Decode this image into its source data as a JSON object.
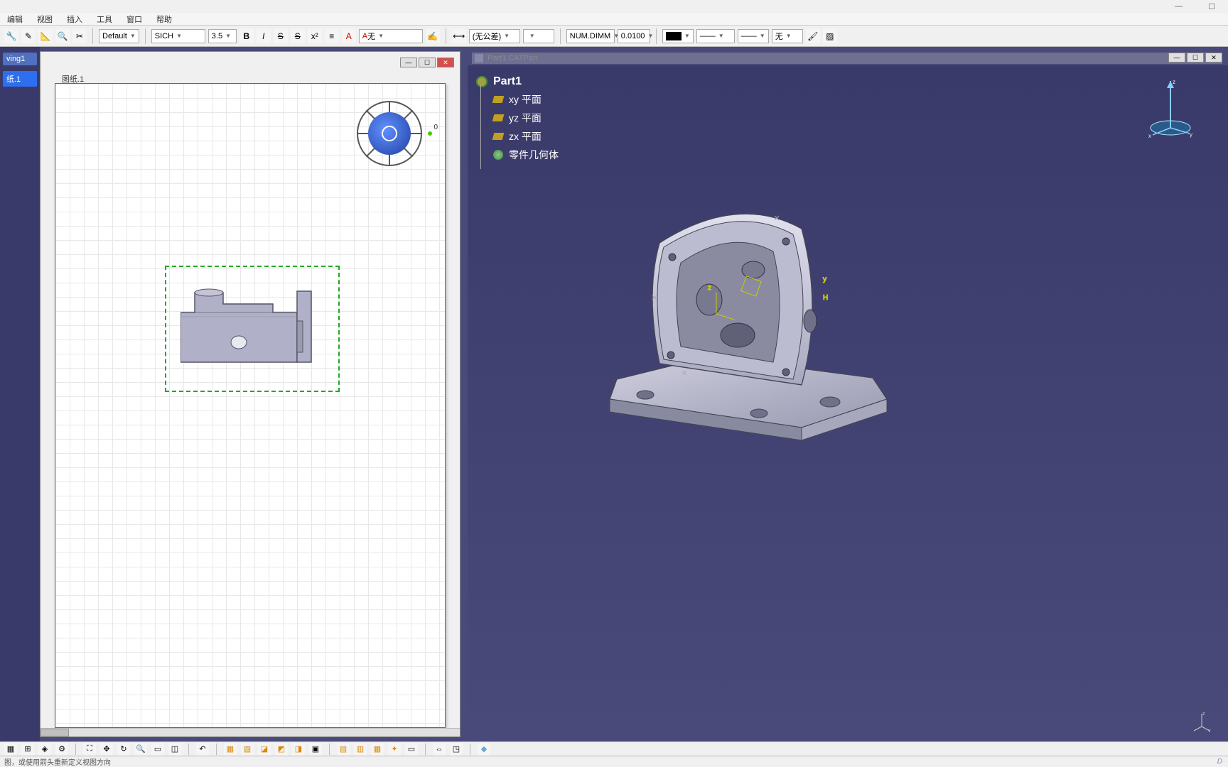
{
  "titlebar": {
    "minimize": "—",
    "maximize": "☐",
    "close": "✕"
  },
  "menu": {
    "items": [
      "编辑",
      "视图",
      "插入",
      "工具",
      "窗口",
      "帮助"
    ]
  },
  "toolbar": {
    "style_select": "Default",
    "font_select": "SICH",
    "size_select": "3.5",
    "bold": "B",
    "italic": "I",
    "strike": "S",
    "strike2": "S",
    "super": "x²",
    "align": "≡",
    "anchor": "A",
    "frame_select": "无",
    "tol_select": "(无公差)",
    "tol_value": "",
    "dim_mode": "NUM.DIMM",
    "precision": "0.0100",
    "color": "#000000",
    "line1": "——",
    "line2": "——",
    "line3": "无"
  },
  "drawing": {
    "tree_items": [
      "ving1",
      "纸.1"
    ],
    "sheet_tab": "图纸.1",
    "compass_label": "0"
  },
  "part3d": {
    "window_title": "Part1.CATPart",
    "root": "Part1",
    "planes": [
      "xy 平面",
      "yz 平面",
      "zx 平面"
    ],
    "body": "零件几何体",
    "axes": {
      "x": "x",
      "y": "y",
      "z": "z"
    }
  },
  "status": {
    "hint": "图，或使用箭头重新定义视图方向",
    "brand": "D"
  }
}
